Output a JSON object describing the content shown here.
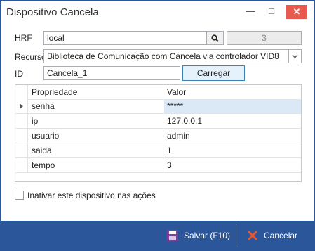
{
  "window": {
    "title": "Dispositivo Cancela",
    "minimize_glyph": "—",
    "maximize_glyph": "□",
    "close_glyph": "✕"
  },
  "form": {
    "hrf_label": "HRF",
    "hrf_value": "local",
    "hrf_counter": "3",
    "recurso_label": "Recurso",
    "recurso_value": "Biblioteca de Comunicação com Cancela via controlador VID8",
    "id_label": "ID",
    "id_value": "Cancela_1",
    "carregar_label": "Carregar"
  },
  "grid": {
    "col_propriedade": "Propriedade",
    "col_valor": "Valor",
    "rows": [
      {
        "prop": "senha",
        "valor": "*****"
      },
      {
        "prop": "ip",
        "valor": "127.0.0.1"
      },
      {
        "prop": "usuario",
        "valor": "admin"
      },
      {
        "prop": "saida",
        "valor": "1"
      },
      {
        "prop": "tempo",
        "valor": "3"
      }
    ]
  },
  "inativar_label": "Inativar este dispositivo nas ações",
  "inativar_checked": false,
  "footer": {
    "salvar_label": "Salvar (F10)",
    "cancelar_label": "Cancelar"
  },
  "colors": {
    "accent": "#2b579a",
    "selected_row": "#dbe9f7",
    "close": "#e85a4f",
    "cancel_icon": "#e8542b"
  }
}
